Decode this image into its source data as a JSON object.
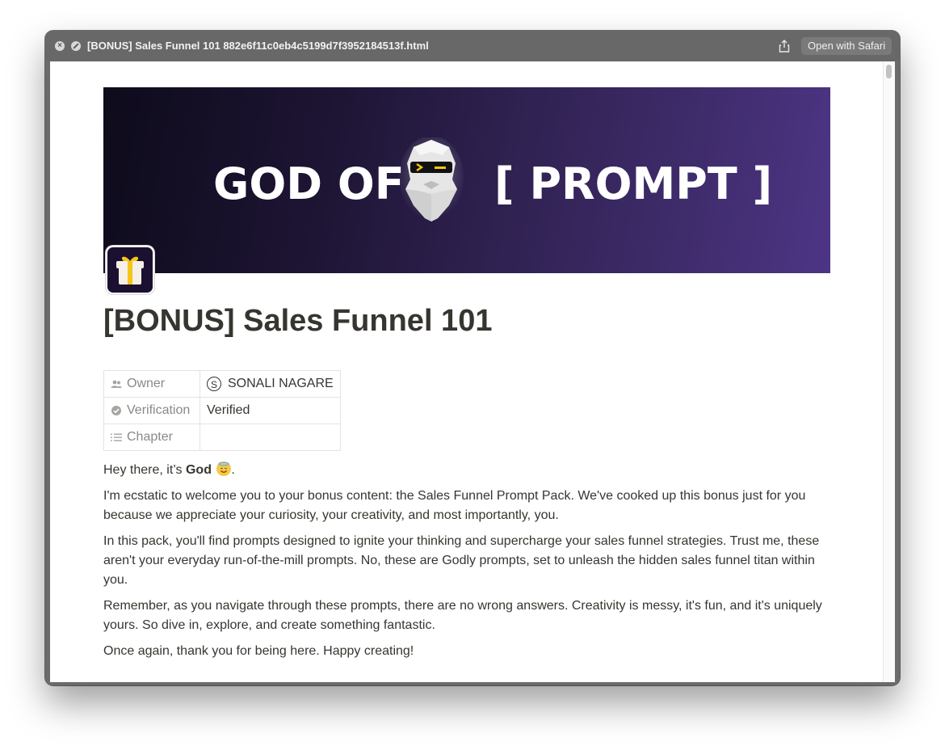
{
  "window": {
    "title": "[BONUS] Sales Funnel 101 882e6f11c0eb4c5199d7f3952184513f.html",
    "open_with_label": "Open with Safari"
  },
  "banner": {
    "left_text": "GOD OF",
    "right_text": "[ PROMPT ]"
  },
  "page": {
    "title": "[BONUS] Sales Funnel 101",
    "icon": "gift-icon"
  },
  "properties": [
    {
      "key": "Owner",
      "icon": "people-icon",
      "value": "SONALI NAGARE",
      "avatar": "S"
    },
    {
      "key": "Verification",
      "icon": "verified-icon",
      "value": "Verified"
    },
    {
      "key": "Chapter",
      "icon": "list-icon",
      "value": ""
    }
  ],
  "body": {
    "greeting_prefix": "Hey there, it’s ",
    "greeting_bold": "God",
    "greeting_suffix": ".",
    "paragraphs": [
      "I'm ecstatic to welcome you to your bonus content: the Sales Funnel Prompt Pack. We've cooked up this bonus just for you because we appreciate your curiosity, your creativity, and most importantly, you.",
      "In this pack, you'll find prompts designed to ignite your thinking and supercharge your sales funnel strategies. Trust me, these aren't your everyday run-of-the-mill prompts. No, these are Godly prompts, set to unleash the hidden sales funnel titan within you.",
      "Remember, as you navigate through these prompts, there are no wrong answers. Creativity is messy, it's fun, and it's uniquely yours. So dive in, explore, and create something fantastic.",
      "Once again, thank you for being here. Happy creating!"
    ]
  },
  "colors": {
    "text": "#37352f",
    "muted": "#8a8985",
    "banner_dark": "#0e0b1b",
    "banner_purple": "#4d3585",
    "accent_yellow": "#f5c518"
  }
}
